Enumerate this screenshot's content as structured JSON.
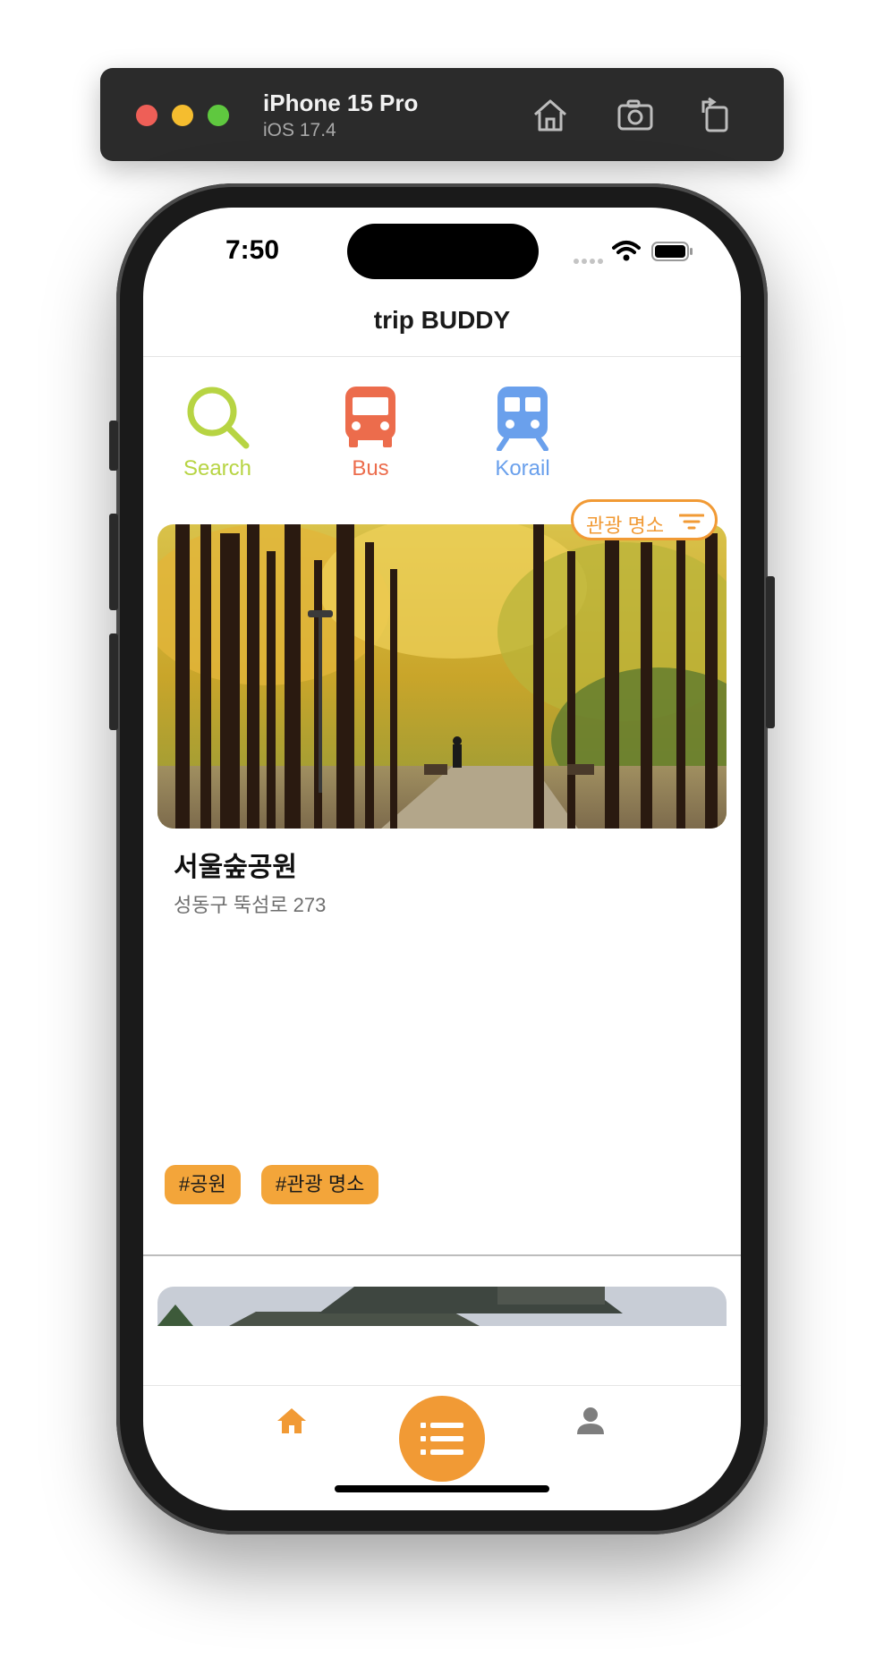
{
  "simulator": {
    "device_name": "iPhone 15 Pro",
    "os_version": "iOS 17.4",
    "icons": [
      "home-icon",
      "screenshot-icon",
      "rotate-icon"
    ]
  },
  "status_bar": {
    "time": "7:50"
  },
  "app": {
    "title": "trip BUDDY"
  },
  "quick_actions": [
    {
      "label": "Search",
      "icon": "search-icon",
      "color": "#b7d443"
    },
    {
      "label": "Bus",
      "icon": "bus-icon",
      "color": "#ec6c4c"
    },
    {
      "label": "Korail",
      "icon": "train-icon",
      "color": "#6aa0ec"
    }
  ],
  "filter": {
    "label": "관광 명소",
    "icon": "filter-icon"
  },
  "places": [
    {
      "name": "서울숲공원",
      "address": "성동구 뚝섬로 273",
      "tags": [
        "#공원",
        "#관광 명소"
      ]
    }
  ],
  "tab_bar": {
    "items": [
      "home-icon",
      "list-icon",
      "person-icon"
    ],
    "active": "home-icon"
  },
  "colors": {
    "accent": "#f19a35",
    "tag_bg": "#f3a53a"
  }
}
